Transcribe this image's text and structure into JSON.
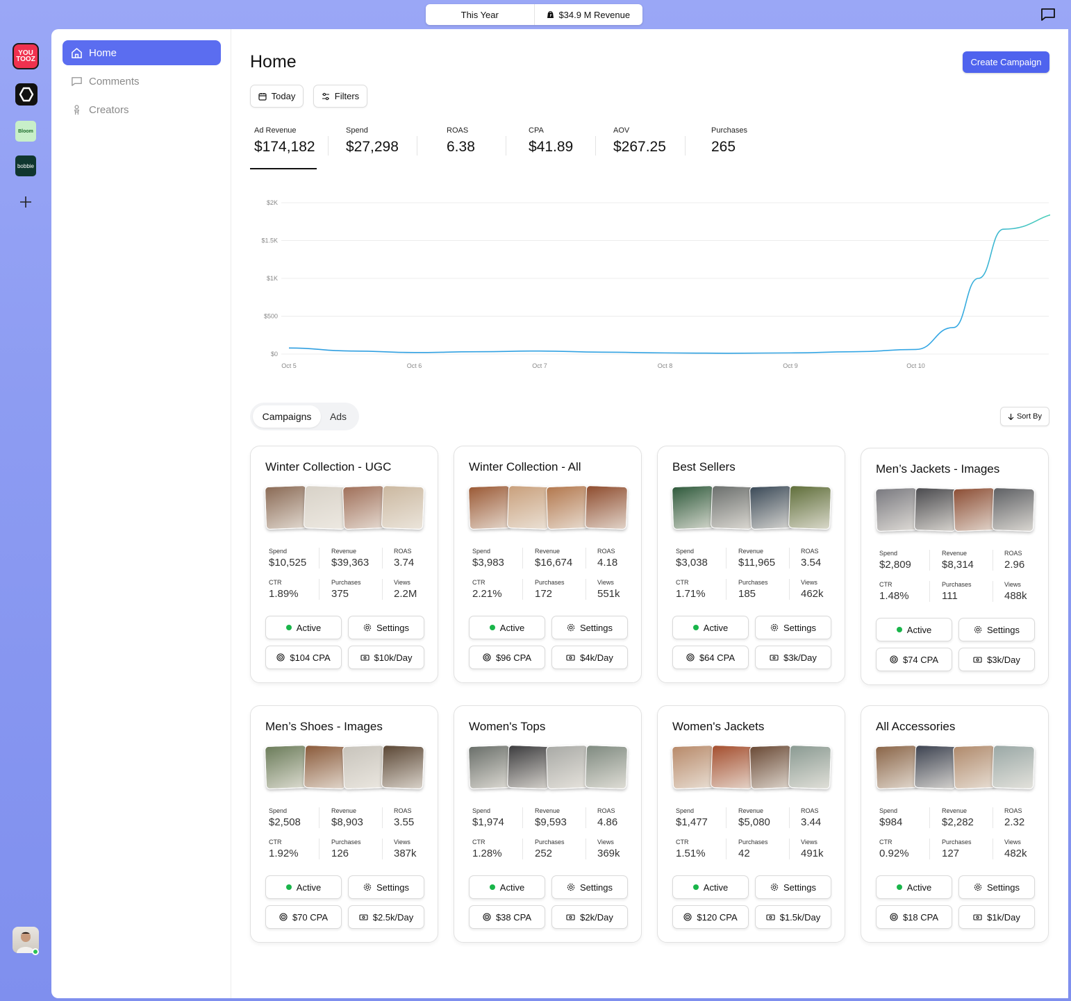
{
  "topbar": {
    "period": "This Year",
    "revenue": "$34.9 M Revenue"
  },
  "rail": {
    "youtooz_logo": "YOU TOOZ",
    "bloom_logo": "Bloom",
    "bobbie_logo": "bobbie"
  },
  "sidebar": {
    "items": [
      {
        "label": "Home",
        "icon": "home-icon"
      },
      {
        "label": "Comments",
        "icon": "comment-icon"
      },
      {
        "label": "Creators",
        "icon": "creator-icon"
      }
    ]
  },
  "header": {
    "title": "Home",
    "create_label": "Create Campaign",
    "today_label": "Today",
    "filters_label": "Filters"
  },
  "kpis": [
    {
      "label": "Ad Revenue",
      "value": "$174,182"
    },
    {
      "label": "Spend",
      "value": "$27,298"
    },
    {
      "label": "ROAS",
      "value": "6.38"
    },
    {
      "label": "CPA",
      "value": "$41.89"
    },
    {
      "label": "AOV",
      "value": "$267.25"
    },
    {
      "label": "Purchases",
      "value": "265"
    }
  ],
  "chart_data": {
    "type": "line",
    "title": "",
    "xlabel": "",
    "ylabel": "",
    "x": [
      "Oct 5",
      "Oct 6",
      "Oct 7",
      "Oct 8",
      "Oct 9",
      "Oct 10"
    ],
    "yticks": [
      "$0",
      "$500",
      "$1K",
      "$1.5K",
      "$2K"
    ],
    "ylim": [
      0,
      2000
    ],
    "grid": true,
    "series": [
      {
        "color": "#34a9e0",
        "points": [
          [
            0,
            80
          ],
          [
            0.5,
            40
          ],
          [
            1,
            20
          ],
          [
            1.5,
            30
          ],
          [
            2,
            40
          ],
          [
            2.5,
            25
          ],
          [
            3,
            15
          ],
          [
            3.5,
            10
          ],
          [
            4,
            15
          ],
          [
            4.5,
            30
          ],
          [
            5,
            60
          ],
          [
            5.3,
            350
          ],
          [
            5.5,
            1000
          ],
          [
            5.7,
            1650
          ],
          [
            6.0,
            1870
          ]
        ]
      }
    ]
  },
  "tabs": {
    "campaigns": "Campaigns",
    "ads": "Ads"
  },
  "sort_label": "Sort By",
  "labels": {
    "spend": "Spend",
    "revenue": "Revenue",
    "roas": "ROAS",
    "ctr": "CTR",
    "purchases": "Purchases",
    "views": "Views",
    "active": "Active",
    "settings": "Settings"
  },
  "campaigns": [
    {
      "title": "Winter Collection - UGC",
      "spend": "$10,525",
      "revenue": "$39,363",
      "roas": "3.74",
      "ctr": "1.89%",
      "purchases": "375",
      "views": "2.2M",
      "cpa": "$104 CPA",
      "budget": "$10k/Day",
      "palette": [
        "#8a6a55",
        "#d8d2c8",
        "#a0705a",
        "#cbb8a0"
      ]
    },
    {
      "title": "Winter Collection - All",
      "spend": "$3,983",
      "revenue": "$16,674",
      "roas": "4.18",
      "ctr": "2.21%",
      "purchases": "172",
      "views": "551k",
      "cpa": "$96 CPA",
      "budget": "$4k/Day",
      "palette": [
        "#9b5a36",
        "#c9a07c",
        "#b3784e",
        "#8e4c2e"
      ]
    },
    {
      "title": "Best Sellers",
      "spend": "$3,038",
      "revenue": "$11,965",
      "roas": "3.54",
      "ctr": "1.71%",
      "purchases": "185",
      "views": "462k",
      "cpa": "$64 CPA",
      "budget": "$3k/Day",
      "palette": [
        "#2f5a3c",
        "#6b6f6d",
        "#3b4a58",
        "#5f6e3a"
      ]
    },
    {
      "title": "Men’s Jackets - Images",
      "spend": "$2,809",
      "revenue": "$8,314",
      "roas": "2.96",
      "ctr": "1.48%",
      "purchases": "111",
      "views": "488k",
      "cpa": "$74 CPA",
      "budget": "$3k/Day",
      "palette": [
        "#7a7a80",
        "#4a4a4e",
        "#8c4e35",
        "#5e6064"
      ]
    },
    {
      "title": "Men’s Shoes - Images",
      "spend": "$2,508",
      "revenue": "$8,903",
      "roas": "3.55",
      "ctr": "1.92%",
      "purchases": "126",
      "views": "387k",
      "cpa": "$70 CPA",
      "budget": "$2.5k/Day",
      "palette": [
        "#6b7c5a",
        "#8a5a3a",
        "#c8c4bc",
        "#5a4634"
      ]
    },
    {
      "title": "Women's Tops",
      "spend": "$1,974",
      "revenue": "$9,593",
      "roas": "4.86",
      "ctr": "1.28%",
      "purchases": "252",
      "views": "369k",
      "cpa": "$38 CPA",
      "budget": "$2k/Day",
      "palette": [
        "#6a6f6a",
        "#3c3c3e",
        "#a9aaa6",
        "#7f8a80"
      ]
    },
    {
      "title": "Women's Jackets",
      "spend": "$1,477",
      "revenue": "$5,080",
      "roas": "3.44",
      "ctr": "1.51%",
      "purchases": "42",
      "views": "491k",
      "cpa": "$120 CPA",
      "budget": "$1.5k/Day",
      "palette": [
        "#b88a6a",
        "#a44e2e",
        "#6a4a36",
        "#8a9a92"
      ]
    },
    {
      "title": "All Accessories",
      "spend": "$984",
      "revenue": "$2,282",
      "roas": "2.32",
      "ctr": "0.92%",
      "purchases": "127",
      "views": "482k",
      "cpa": "$18 CPA",
      "budget": "$1k/Day",
      "palette": [
        "#8a6548",
        "#3c4250",
        "#b08a6c",
        "#9aa8a6"
      ]
    }
  ]
}
